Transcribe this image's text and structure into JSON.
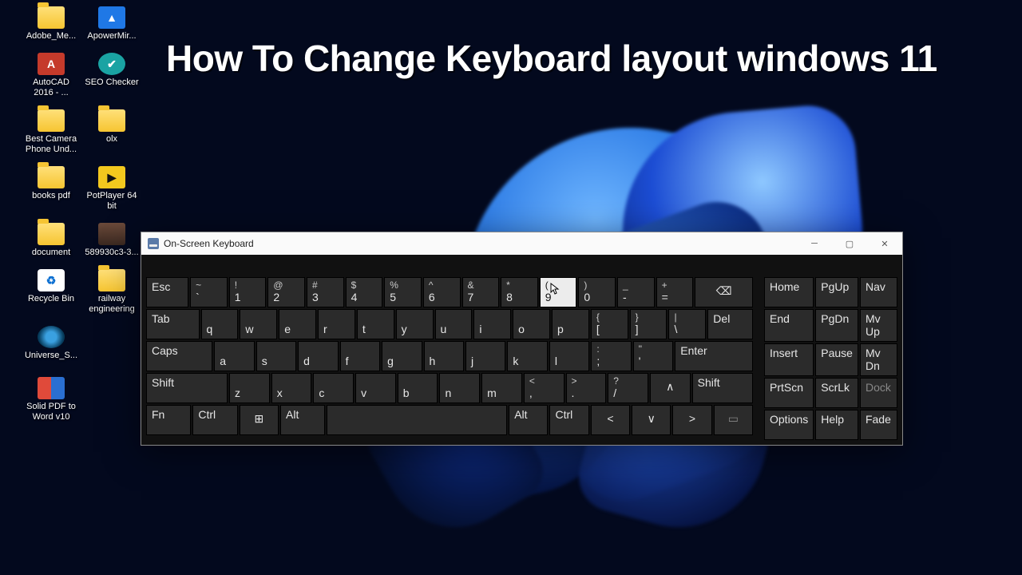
{
  "headline": "How  To Change Keyboard layout  windows 11",
  "desktop_icons": [
    {
      "label": "Adobe_Me...",
      "kind": "folder"
    },
    {
      "label": "ApowerMir...",
      "kind": "app-blue"
    },
    {
      "label": "AutoCAD 2016 - ...",
      "kind": "app-red"
    },
    {
      "label": "SEO Checker",
      "kind": "app-teal"
    },
    {
      "label": "Best Camera Phone Und...",
      "kind": "folder"
    },
    {
      "label": "olx",
      "kind": "folder"
    },
    {
      "label": "books pdf",
      "kind": "folder"
    },
    {
      "label": "PotPlayer 64 bit",
      "kind": "app-yellow"
    },
    {
      "label": "document",
      "kind": "folder"
    },
    {
      "label": "589930c3-3...",
      "kind": "image"
    },
    {
      "label": "Recycle Bin",
      "kind": "bin"
    },
    {
      "label": "railway engineering",
      "kind": "folder"
    },
    {
      "label": "Universe_S...",
      "kind": "app-disc"
    },
    {
      "label": "",
      "kind": "spacer"
    },
    {
      "label": "Solid PDF to Word v10",
      "kind": "app-doc"
    }
  ],
  "osk": {
    "title": "On-Screen Keyboard",
    "row1": [
      {
        "label": "Esc",
        "w": 1.2,
        "top": true
      },
      {
        "sup": "~",
        "label": "`"
      },
      {
        "sup": "!",
        "label": "1"
      },
      {
        "sup": "@",
        "label": "2"
      },
      {
        "sup": "#",
        "label": "3"
      },
      {
        "sup": "$",
        "label": "4"
      },
      {
        "sup": "%",
        "label": "5"
      },
      {
        "sup": "^",
        "label": "6"
      },
      {
        "sup": "&",
        "label": "7"
      },
      {
        "sup": "*",
        "label": "8"
      },
      {
        "sup": "(",
        "label": "9",
        "hover": true
      },
      {
        "sup": ")",
        "label": "0"
      },
      {
        "sup": "_",
        "label": "-"
      },
      {
        "sup": "+",
        "label": "="
      },
      {
        "label": "⌫",
        "w": 1.8,
        "icon": true
      }
    ],
    "row2": [
      {
        "label": "Tab",
        "w": 1.6,
        "top": true
      },
      {
        "label": "q"
      },
      {
        "label": "w"
      },
      {
        "label": "e"
      },
      {
        "label": "r"
      },
      {
        "label": "t"
      },
      {
        "label": "y"
      },
      {
        "label": "u"
      },
      {
        "label": "i"
      },
      {
        "label": "o"
      },
      {
        "label": "p"
      },
      {
        "sup": "{",
        "label": "["
      },
      {
        "sup": "}",
        "label": "]"
      },
      {
        "sup": "|",
        "label": "\\"
      },
      {
        "label": "Del",
        "w": 1.3,
        "top": true
      }
    ],
    "row3": [
      {
        "label": "Caps",
        "w": 1.9,
        "top": true
      },
      {
        "label": "a"
      },
      {
        "label": "s"
      },
      {
        "label": "d"
      },
      {
        "label": "f"
      },
      {
        "label": "g"
      },
      {
        "label": "h"
      },
      {
        "label": "j"
      },
      {
        "label": "k"
      },
      {
        "label": "l"
      },
      {
        "sup": ":",
        "label": ";"
      },
      {
        "sup": "\"",
        "label": "'"
      },
      {
        "label": "Enter",
        "w": 2.3,
        "top": true
      }
    ],
    "row4": [
      {
        "label": "Shift",
        "w": 2.4,
        "top": true
      },
      {
        "label": "z"
      },
      {
        "label": "x"
      },
      {
        "label": "c"
      },
      {
        "label": "v"
      },
      {
        "label": "b"
      },
      {
        "label": "n"
      },
      {
        "label": "m"
      },
      {
        "sup": "<",
        "label": ","
      },
      {
        "sup": ">",
        "label": "."
      },
      {
        "sup": "?",
        "label": "/"
      },
      {
        "label": "∧",
        "icon": true
      },
      {
        "label": "Shift",
        "w": 1.7,
        "top": true
      }
    ],
    "row5": [
      {
        "label": "Fn",
        "w": 1.2,
        "top": true
      },
      {
        "label": "Ctrl",
        "w": 1.2,
        "top": true
      },
      {
        "label": "⊞",
        "icon": true
      },
      {
        "label": "Alt",
        "w": 1.2,
        "top": true
      },
      {
        "label": "",
        "w": 6
      },
      {
        "label": "Alt",
        "top": true
      },
      {
        "label": "Ctrl",
        "top": true
      },
      {
        "label": "<",
        "icon": true
      },
      {
        "label": "∨",
        "icon": true
      },
      {
        "label": ">",
        "icon": true
      },
      {
        "label": "▭",
        "icon": true,
        "dim": true
      }
    ],
    "side": [
      [
        "Home",
        "PgUp",
        "Nav"
      ],
      [
        "End",
        "PgDn",
        "Mv Up"
      ],
      [
        "Insert",
        "Pause",
        "Mv Dn"
      ],
      [
        "PrtScn",
        "ScrLk",
        "Dock"
      ],
      [
        "Options",
        "Help",
        "Fade"
      ]
    ],
    "side_dim": [
      "Dock"
    ]
  }
}
